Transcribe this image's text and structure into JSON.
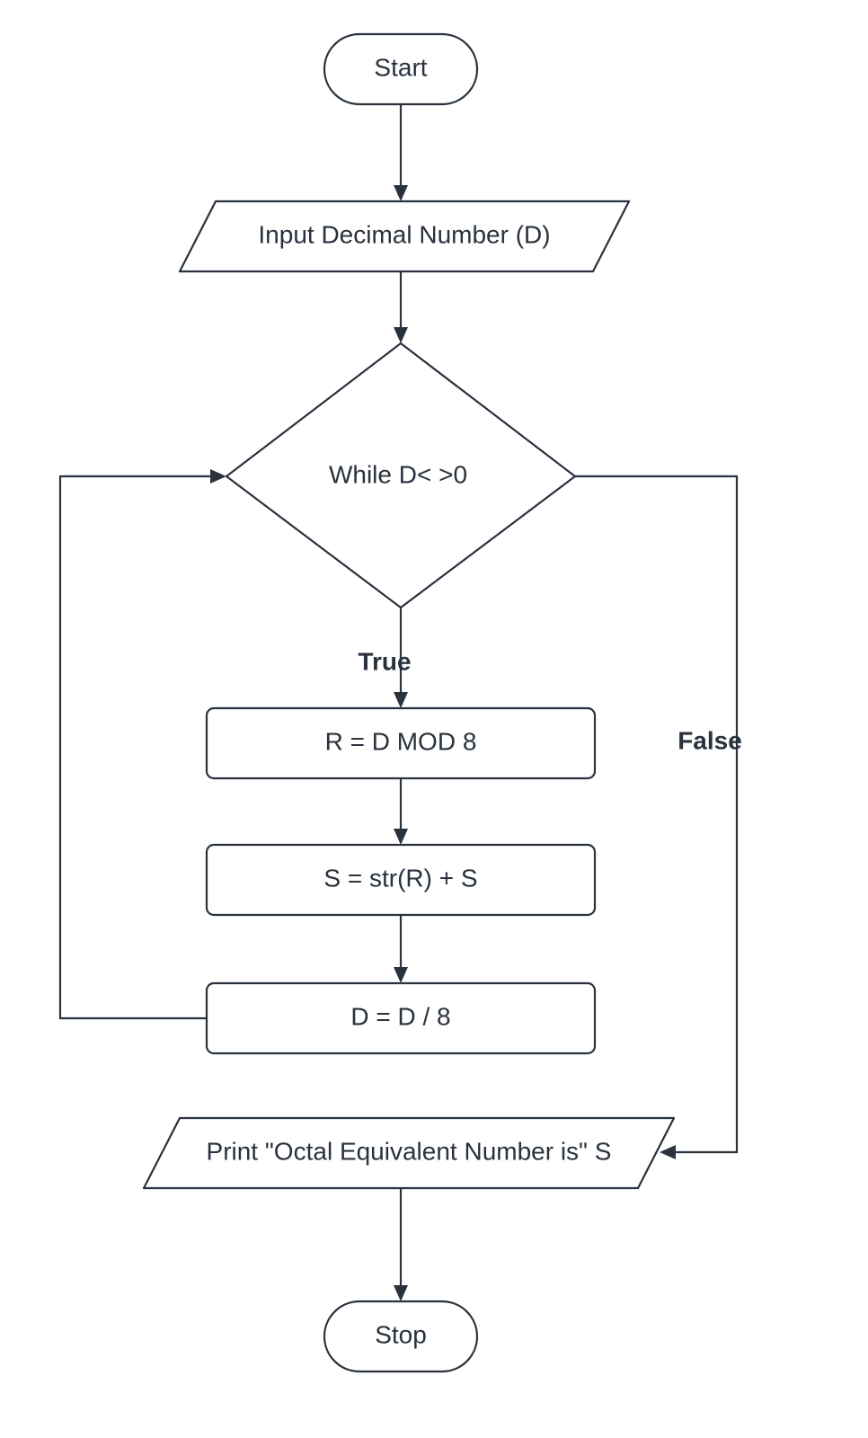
{
  "nodes": {
    "start": "Start",
    "input": "Input  Decimal Number (D)",
    "decision": "While  D< >0",
    "process1": "R = D MOD 8",
    "process2": "S = str(R) + S",
    "process3": "D = D / 8",
    "output": "Print \"Octal Equivalent Number is\"  S",
    "stop": "Stop"
  },
  "edges": {
    "true": "True",
    "false": "False"
  }
}
